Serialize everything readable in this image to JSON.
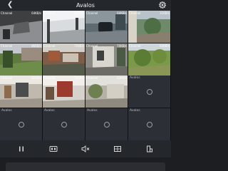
{
  "header": {
    "title": "Avalos",
    "back_icon": "chevron-left-icon",
    "settings_icon": "gear-icon"
  },
  "tiles": [
    {
      "label": "Channel",
      "speed": "64KB/s"
    },
    {
      "label": "Channel",
      "speed": "53KB/s"
    },
    {
      "label": "Channel",
      "speed": "64KB/s"
    },
    {
      "label": "Channel",
      "speed": "31KB/s"
    },
    {
      "label": "Channel",
      "speed": "86KB/s"
    },
    {
      "label": "Channel",
      "speed": "71KB/s"
    },
    {
      "label": "Channel",
      "speed": "70KB/s"
    },
    {
      "label": "Channel",
      "speed": "64KB/s"
    },
    {
      "label": "Channel",
      "speed": "82KB/s"
    },
    {
      "label": "Channel",
      "speed": "76KB/s"
    },
    {
      "label": "Channel",
      "speed": "63KB/s"
    }
  ],
  "empty_tiles": [
    {
      "device": "Avalos"
    },
    {
      "device": "Avalos"
    },
    {
      "device": "Avalos"
    },
    {
      "device": "Avalos"
    },
    {
      "device": "Avalos"
    }
  ],
  "toolbar": {
    "buttons": [
      "pause-icon",
      "hd-icon",
      "mute-icon",
      "split-view-icon",
      "layout-icon"
    ]
  },
  "colors": {
    "background": "#1c1e22",
    "bar": "#24272c",
    "empty_tile": "#2c2f35"
  }
}
